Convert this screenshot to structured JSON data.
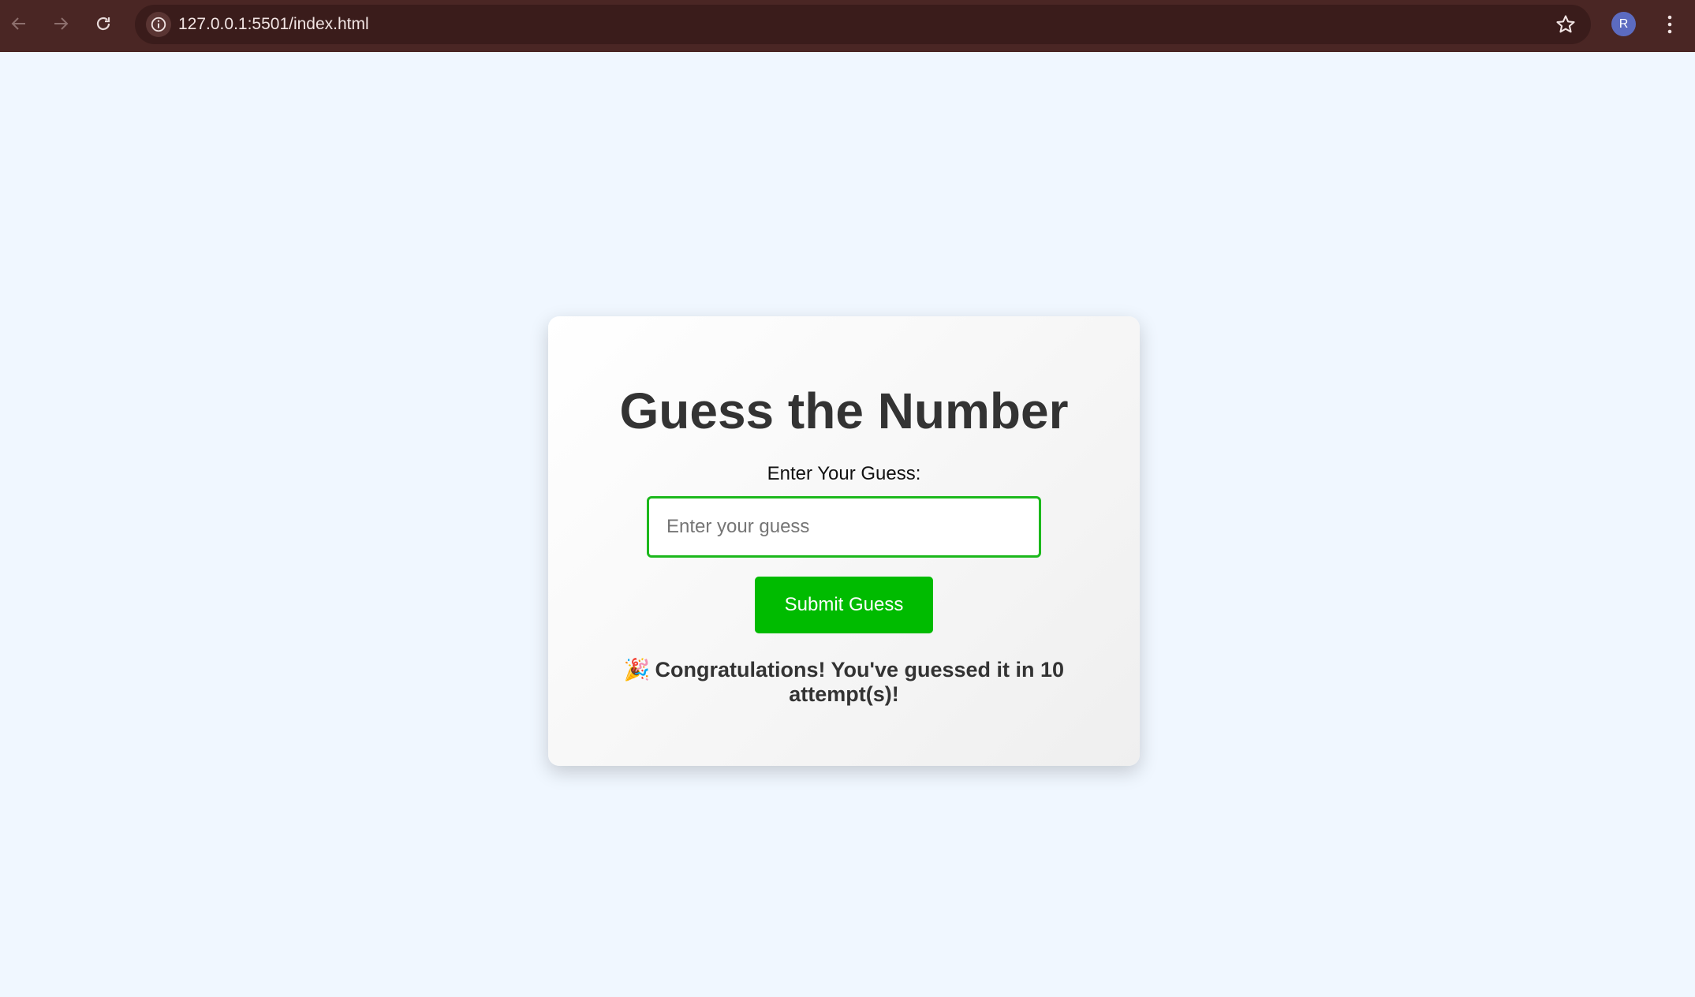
{
  "browser": {
    "url": "127.0.0.1:5501/index.html",
    "profile_initial": "R",
    "icons": {
      "back": "arrow-left-icon",
      "forward": "arrow-right-icon",
      "reload": "reload-icon",
      "site_info": "info-icon",
      "bookmark": "star-icon",
      "menu": "kebab-menu-icon"
    },
    "colors": {
      "toolbar": "#4a2624",
      "omnibox": "#3a1c1b",
      "avatar": "#5c6bc0"
    }
  },
  "game": {
    "title": "Guess the Number",
    "input_label": "Enter Your Guess:",
    "input_placeholder": "Enter your guess",
    "input_value": "",
    "submit_label": "Submit Guess",
    "result_emoji": "🎉",
    "result_message": "Congratulations! You've guessed it in 10 attempt(s)!",
    "colors": {
      "accent": "#00bb00",
      "input_border": "#1cb81c",
      "page_background": "#f0f7ff",
      "text": "#333333"
    }
  }
}
